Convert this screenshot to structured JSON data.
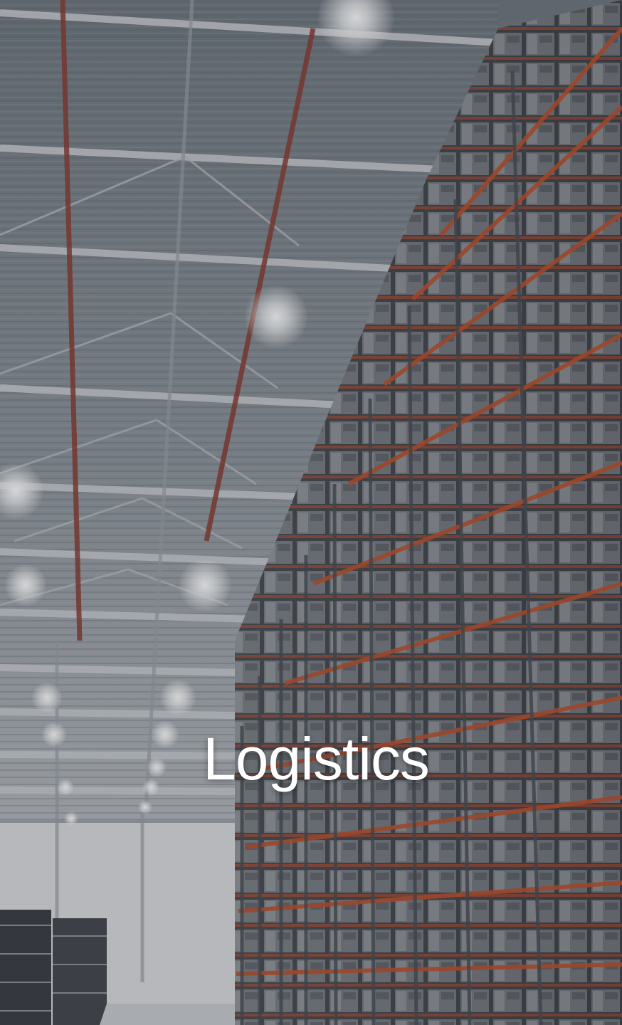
{
  "card": {
    "title": "Logistics"
  },
  "scene": {
    "image_name": "warehouse-photo",
    "colors": {
      "ceiling": "#7f8891",
      "rack_beam": "#b24a2c",
      "boxes": "#9aa0a6",
      "light": "#ffffff"
    }
  }
}
